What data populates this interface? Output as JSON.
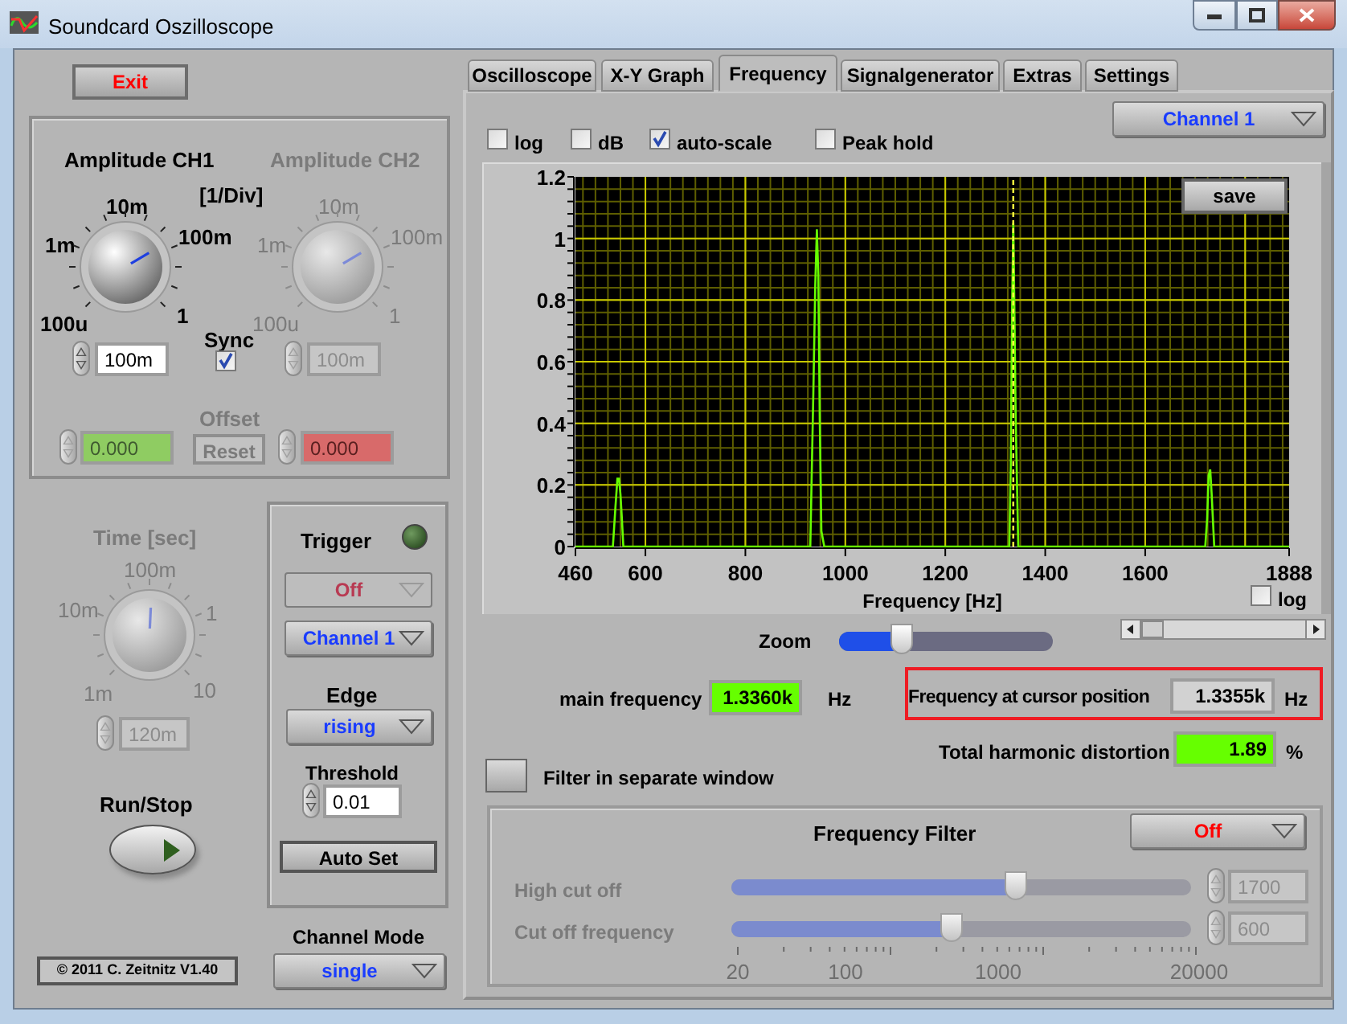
{
  "window": {
    "title": "Soundcard Oszilloscope"
  },
  "exit_button": {
    "label": "Exit"
  },
  "amplitude": {
    "channels": [
      {
        "title": "Amplitude CH1",
        "disabled": false,
        "scale": [
          "100u",
          "1m",
          "10m",
          "100m",
          "1"
        ],
        "value": "100m"
      },
      {
        "title": "Amplitude CH2",
        "disabled": true,
        "scale": [
          "100u",
          "1m",
          "10m",
          "100m",
          "1"
        ],
        "value": "100m"
      }
    ],
    "unit": "[1/Div]",
    "sync": {
      "label": "Sync",
      "checked": true
    },
    "offset": {
      "label": "Offset",
      "disabled": true,
      "ch1": "0.000",
      "ch2": "0.000",
      "reset": "Reset"
    }
  },
  "time": {
    "title": "Time [sec]",
    "disabled": true,
    "scale": [
      "1m",
      "10m",
      "100m",
      "1",
      "10"
    ],
    "value": "120m"
  },
  "run_stop": {
    "label": "Run/Stop"
  },
  "trigger": {
    "title": "Trigger",
    "led_on": false,
    "mode": "Off",
    "mode_disabled": true,
    "channel": "Channel 1",
    "edge_label": "Edge",
    "edge": "rising",
    "threshold_label": "Threshold",
    "threshold": "0.01",
    "auto_set": "Auto Set"
  },
  "channel_mode": {
    "label": "Channel Mode",
    "value": "single"
  },
  "copyright": "© 2011  C. Zeitnitz V1.40",
  "tabs": [
    {
      "label": "Oscilloscope",
      "selected": false
    },
    {
      "label": "X-Y Graph",
      "selected": false
    },
    {
      "label": "Frequency",
      "selected": true
    },
    {
      "label": "Signalgenerator",
      "selected": false
    },
    {
      "label": "Extras",
      "selected": false
    },
    {
      "label": "Settings",
      "selected": false
    }
  ],
  "channel_select": "Channel 1",
  "options": [
    {
      "label": "log",
      "checked": false
    },
    {
      "label": "dB",
      "checked": false
    },
    {
      "label": "auto-scale",
      "checked": true
    },
    {
      "label": "Peak hold",
      "checked": false
    }
  ],
  "graph": {
    "save": "save",
    "x_log": {
      "label": "log",
      "checked": false
    },
    "chart_data": {
      "type": "line",
      "grid": true,
      "xlabel": "Frequency [Hz]",
      "xlim": [
        460,
        1888
      ],
      "ylim": [
        0,
        1.2
      ],
      "xticks": [
        460,
        600,
        800,
        1000,
        1200,
        1400,
        1600,
        1888
      ],
      "yticks": [
        0,
        0.2,
        0.4,
        0.6,
        0.8,
        1,
        1.2
      ],
      "x": [
        460,
        535,
        540,
        544,
        547,
        550,
        553,
        556,
        562,
        930,
        936,
        940,
        943,
        946,
        949,
        952,
        958,
        1328,
        1331,
        1334,
        1336,
        1338,
        1341,
        1346,
        1720,
        1724,
        1727,
        1730,
        1733,
        1738,
        1888
      ],
      "series": [
        {
          "color": "#66ff00",
          "values": [
            0,
            0,
            0.13,
            0.22,
            0.22,
            0.17,
            0.09,
            0,
            0,
            0,
            0.5,
            0.85,
            1.03,
            0.88,
            0.41,
            0.05,
            0,
            0,
            0.26,
            0.79,
            1.05,
            0.81,
            0.41,
            0,
            0,
            0.09,
            0.23,
            0.25,
            0.17,
            0,
            0
          ]
        }
      ],
      "ref_lines": [
        {
          "axis": "x",
          "value": 1336
        }
      ]
    }
  },
  "zoom": {
    "label": "Zoom",
    "level": 0.29
  },
  "main_frequency": {
    "label": "main frequency",
    "value": "1.3360k",
    "unit": "Hz"
  },
  "cursor_frequency": {
    "label": "Frequency at cursor position",
    "value": "1.3355k",
    "unit": "Hz",
    "highlighted": true
  },
  "thd": {
    "label": "Total harmonic distortion",
    "value": "1.89",
    "unit": "%"
  },
  "filter_window": {
    "label": "Filter in separate window",
    "on": false
  },
  "frequency_filter": {
    "title": "Frequency Filter",
    "mode": "Off",
    "disabled": true,
    "sliders": [
      {
        "label": "High cut off",
        "level": 0.62,
        "value": "1700"
      },
      {
        "label": "Cut off frequency",
        "level": 0.48,
        "value": "600"
      }
    ],
    "scale": [
      "20",
      "100",
      "1000",
      "20000"
    ]
  }
}
